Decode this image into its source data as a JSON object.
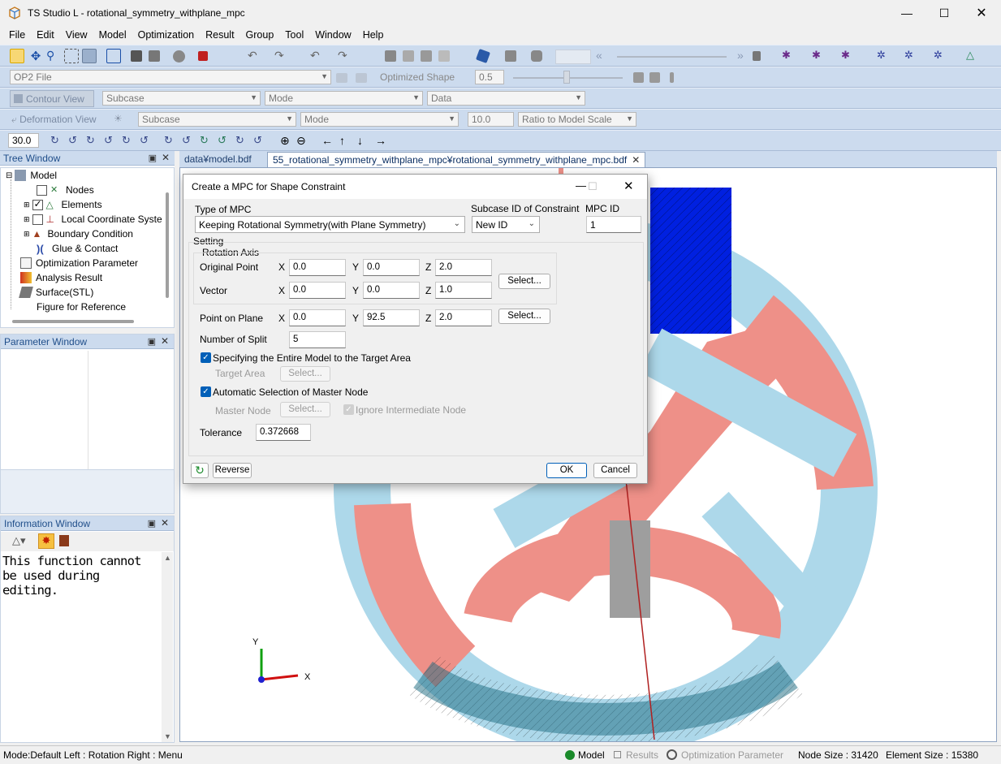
{
  "window": {
    "title": "TS Studio L - rotational_symmetry_withplane_mpc"
  },
  "menu": [
    "File",
    "Edit",
    "View",
    "Model",
    "Optimization",
    "Result",
    "Group",
    "Tool",
    "Window",
    "Help"
  ],
  "toolbar": {
    "op2_file": "OP2 File",
    "optimized_shape_label": "Optimized Shape",
    "optimized_shape_value": "0.5",
    "contour_view_label": "Contour View",
    "contour_subcase": "Subcase",
    "contour_mode": "Mode",
    "contour_data": "Data",
    "deformation_view_label": "Deformation View",
    "deformation_subcase": "Subcase",
    "deformation_mode": "Mode",
    "deformation_scale": "10.0",
    "deformation_ratio": "Ratio to Model Scale",
    "angle_value": "30.0"
  },
  "tree_window": {
    "title": "Tree Window",
    "items": [
      "Model",
      "Nodes",
      "Elements",
      "Local Coordinate Syste",
      "Boundary Condition",
      "Glue & Contact",
      "Optimization Parameter",
      "Analysis Result",
      "Surface(STL)",
      "Figure for Reference"
    ]
  },
  "parameter_window": {
    "title": "Parameter Window"
  },
  "information_window": {
    "title": "Information Window",
    "message": "This function cannot be used during editing."
  },
  "tabs": [
    "data¥model.bdf",
    "55_rotational_symmetry_withplane_mpc¥rotational_symmetry_withplane_mpc.bdf"
  ],
  "dialog": {
    "title": "Create a MPC for Shape Constraint",
    "type_label": "Type of MPC",
    "type_value": "Keeping Rotational Symmetry(with Plane Symmetry)",
    "subcase_label": "Subcase ID of Constraint",
    "subcase_value": "New ID",
    "mpc_id_label": "MPC ID",
    "mpc_id_value": "1",
    "setting_label": "Setting",
    "rotation_axis_label": "Rotation Axis",
    "original_point_label": "Original Point",
    "original_point": {
      "x": "0.0",
      "y": "0.0",
      "z": "2.0"
    },
    "vector_label": "Vector",
    "vector": {
      "x": "0.0",
      "y": "0.0",
      "z": "1.0"
    },
    "point_on_plane_label": "Point on Plane",
    "point_on_plane": {
      "x": "0.0",
      "y": "92.5",
      "z": "2.0"
    },
    "x_label": "X",
    "y_label": "Y",
    "z_label": "Z",
    "select_label": "Select...",
    "number_of_split_label": "Number of Split",
    "number_of_split": "5",
    "entire_model_label": "Specifying the Entire Model to the Target Area",
    "target_area_label": "Target Area",
    "auto_master_label": "Automatic Selection of Master Node",
    "master_node_label": "Master Node",
    "ignore_intermediate_label": "Ignore Intermediate Node",
    "tolerance_label": "Tolerance",
    "tolerance_value": "0.372668",
    "reverse_label": "Reverse",
    "ok_label": "OK",
    "cancel_label": "Cancel"
  },
  "axes": {
    "x": "X",
    "y": "Y"
  },
  "status": {
    "mode": "Mode:Default  Left : Rotation Right : Menu",
    "model": "Model",
    "results": "Results",
    "opt_param": "Optimization Parameter",
    "node_size": "Node Size : 31420",
    "element_size": "Element Size : 15380"
  }
}
